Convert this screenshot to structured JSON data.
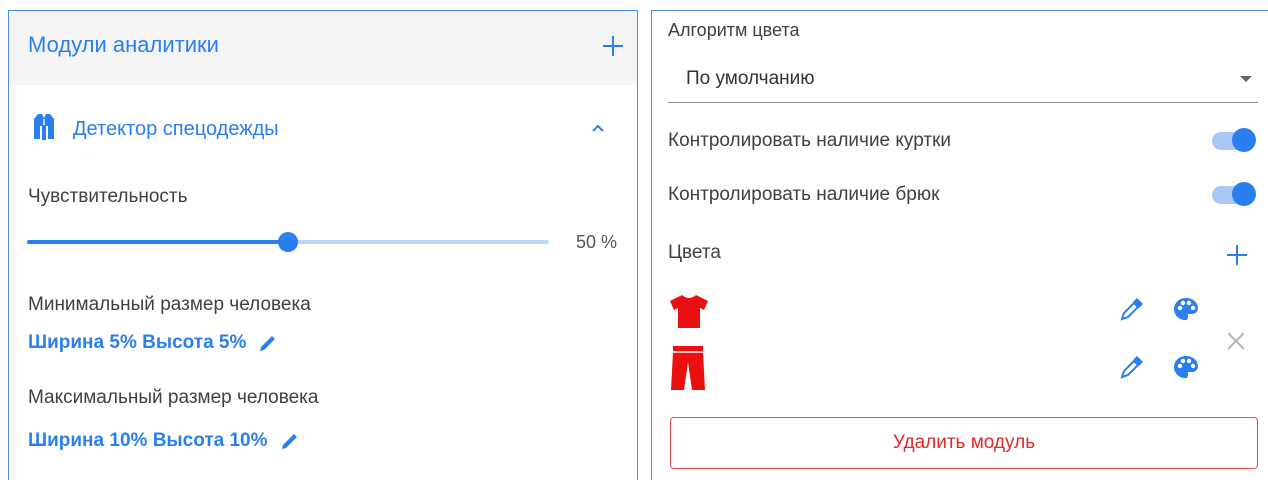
{
  "left": {
    "title": "Модули аналитики",
    "detector": {
      "label": "Детектор спецодежды"
    },
    "sensitivity": {
      "label": "Чувствительность",
      "value": 50,
      "value_text": "50 %"
    },
    "min_size": {
      "label": "Минимальный размер человека",
      "value": "Ширина 5% Высота 5%"
    },
    "max_size": {
      "label": "Максимальный размер человека",
      "value": "Ширина 10% Высота 10%"
    }
  },
  "right": {
    "color_algorithm": {
      "label": "Алгоритм цвета",
      "value": "По умолчанию"
    },
    "jacket_control": {
      "label": "Контролировать наличие куртки",
      "enabled": true
    },
    "pants_control": {
      "label": "Контролировать наличие брюк",
      "enabled": true
    },
    "colors": {
      "label": "Цвета",
      "items": [
        {
          "icon": "shirt-icon",
          "color": "#e81010"
        },
        {
          "icon": "pants-icon",
          "color": "#e81010"
        }
      ]
    },
    "delete_button": "Удалить модуль"
  },
  "colors": {
    "accent": "#2a7ff0",
    "danger": "#e02a2a",
    "item_red": "#e81010"
  }
}
